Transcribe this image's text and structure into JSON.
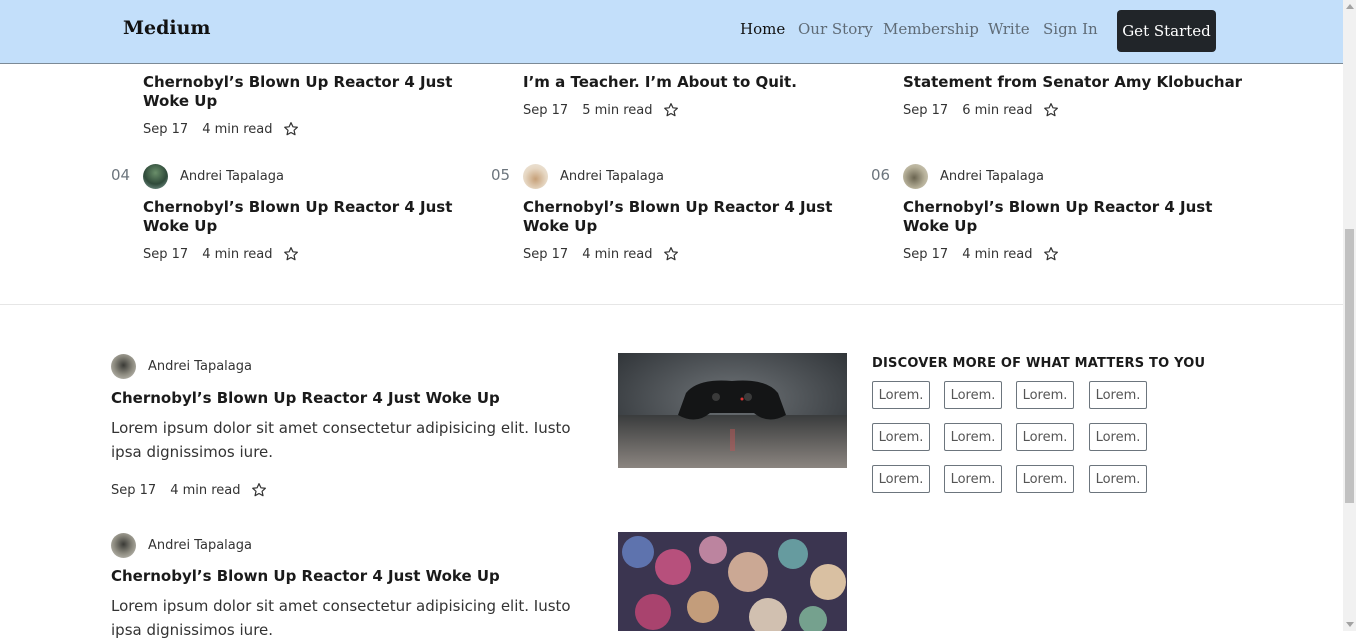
{
  "nav": {
    "brand": "Medium",
    "links": [
      "Home",
      "Our Story",
      "Membership",
      "Write",
      "Sign In"
    ],
    "cta": "Get Started"
  },
  "trending": [
    {
      "title": "Chernobyl’s Blown Up Reactor 4 Just Woke Up",
      "date": "Sep 17",
      "read": "4 min read"
    },
    {
      "title": "I’m a Teacher. I’m About to Quit.",
      "date": "Sep 17",
      "read": "5 min read"
    },
    {
      "title": "Statement from Senator Amy Klobuchar",
      "date": "Sep 17",
      "read": "6 min read"
    },
    {
      "number": "04",
      "author": "Andrei Tapalaga",
      "title": "Chernobyl’s Blown Up Reactor 4 Just Woke Up",
      "date": "Sep 17",
      "read": "4 min read"
    },
    {
      "number": "05",
      "author": "Andrei Tapalaga",
      "title": "Chernobyl’s Blown Up Reactor 4 Just Woke Up",
      "date": "Sep 17",
      "read": "4 min read"
    },
    {
      "number": "06",
      "author": "Andrei Tapalaga",
      "title": "Chernobyl’s Blown Up Reactor 4 Just Woke Up",
      "date": "Sep 17",
      "read": "4 min read"
    }
  ],
  "feed": [
    {
      "author": "Andrei Tapalaga",
      "title": "Chernobyl’s Blown Up Reactor 4 Just Woke Up",
      "desc": "Lorem ipsum dolor sit amet consectetur adipisicing elit. Iusto ipsa dignissimos iure.",
      "date": "Sep 17",
      "read": "4 min read"
    },
    {
      "author": "Andrei Tapalaga",
      "title": "Chernobyl’s Blown Up Reactor 4 Just Woke Up",
      "desc": "Lorem ipsum dolor sit amet consectetur adipisicing elit. Iusto ipsa dignissimos iure."
    }
  ],
  "discover": {
    "heading": "DISCOVER MORE OF WHAT MATTERS TO YOU",
    "tags": [
      "Lorem.",
      "Lorem.",
      "Lorem.",
      "Lorem.",
      "Lorem.",
      "Lorem.",
      "Lorem.",
      "Lorem.",
      "Lorem.",
      "Lorem.",
      "Lorem.",
      "Lorem."
    ]
  },
  "colors": {
    "navbar": "#c3dffa",
    "cta_bg": "#212529",
    "text": "#1a1a1a"
  }
}
